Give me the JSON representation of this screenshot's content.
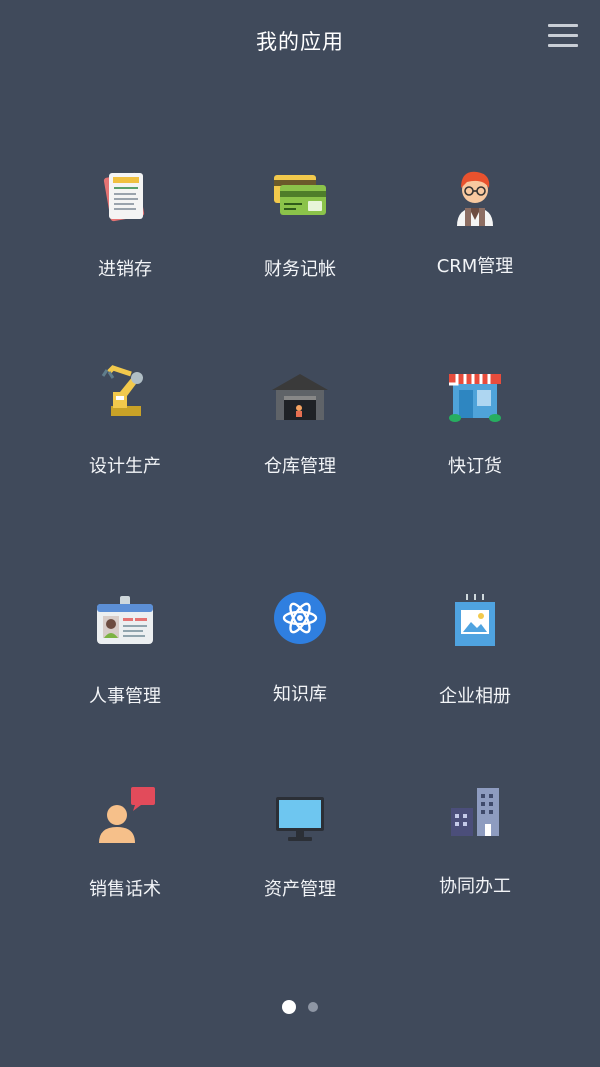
{
  "header": {
    "title": "我的应用"
  },
  "apps": [
    {
      "label": "进销存"
    },
    {
      "label": "财务记帐"
    },
    {
      "label": "CRM管理"
    },
    {
      "label": "设计生产"
    },
    {
      "label": "仓库管理"
    },
    {
      "label": "快订货"
    },
    {
      "label": "人事管理"
    },
    {
      "label": "知识库"
    },
    {
      "label": "企业相册"
    },
    {
      "label": "销售话术"
    },
    {
      "label": "资产管理"
    },
    {
      "label": "协同办工"
    }
  ],
  "icons": {
    "order": "order-document-icon",
    "finance": "credit-card-icon",
    "crm": "person-glasses-icon",
    "design": "robot-arm-icon",
    "warehouse": "warehouse-icon",
    "shop": "storefront-icon",
    "hr": "id-badge-icon",
    "knowledge": "atom-icon",
    "album": "picture-frame-icon",
    "sales": "speaking-person-icon",
    "assets": "monitor-icon",
    "office": "buildings-icon"
  },
  "pager": {
    "total": 2,
    "active": 1
  }
}
